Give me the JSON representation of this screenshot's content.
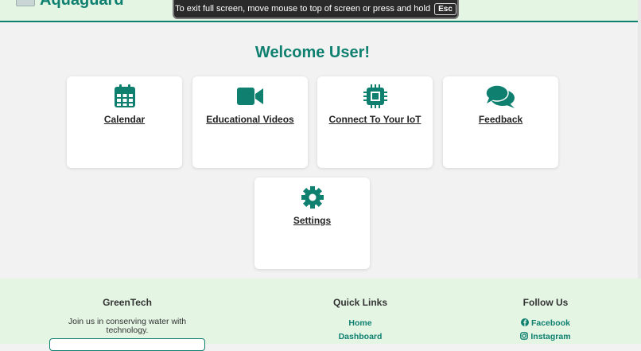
{
  "header": {
    "logo_text": "Aquaguard"
  },
  "fullscreen_banner": {
    "message": "To exit full screen, move mouse to top of screen or press and hold",
    "key": "Esc"
  },
  "main": {
    "welcome": "Welcome User!",
    "cards": [
      {
        "label": "Calendar",
        "icon": "calendar-icon"
      },
      {
        "label": "Educational Videos",
        "icon": "video-camera-icon"
      },
      {
        "label": "Connect To Your IoT",
        "icon": "microchip-icon"
      },
      {
        "label": "Feedback",
        "icon": "comments-icon"
      },
      {
        "label": "Settings",
        "icon": "gear-icon"
      }
    ]
  },
  "footer": {
    "about": {
      "title": "GreenTech",
      "text": "Join us in conserving water with technology."
    },
    "quick_links": {
      "title": "Quick Links",
      "links": [
        "Home",
        "Dashboard"
      ]
    },
    "follow": {
      "title": "Follow Us",
      "links": [
        "Facebook",
        "Instagram"
      ]
    }
  },
  "colors": {
    "accent": "#0f8070",
    "header_bg": "#e4f5e4",
    "page_bg": "#f2f2f2"
  }
}
